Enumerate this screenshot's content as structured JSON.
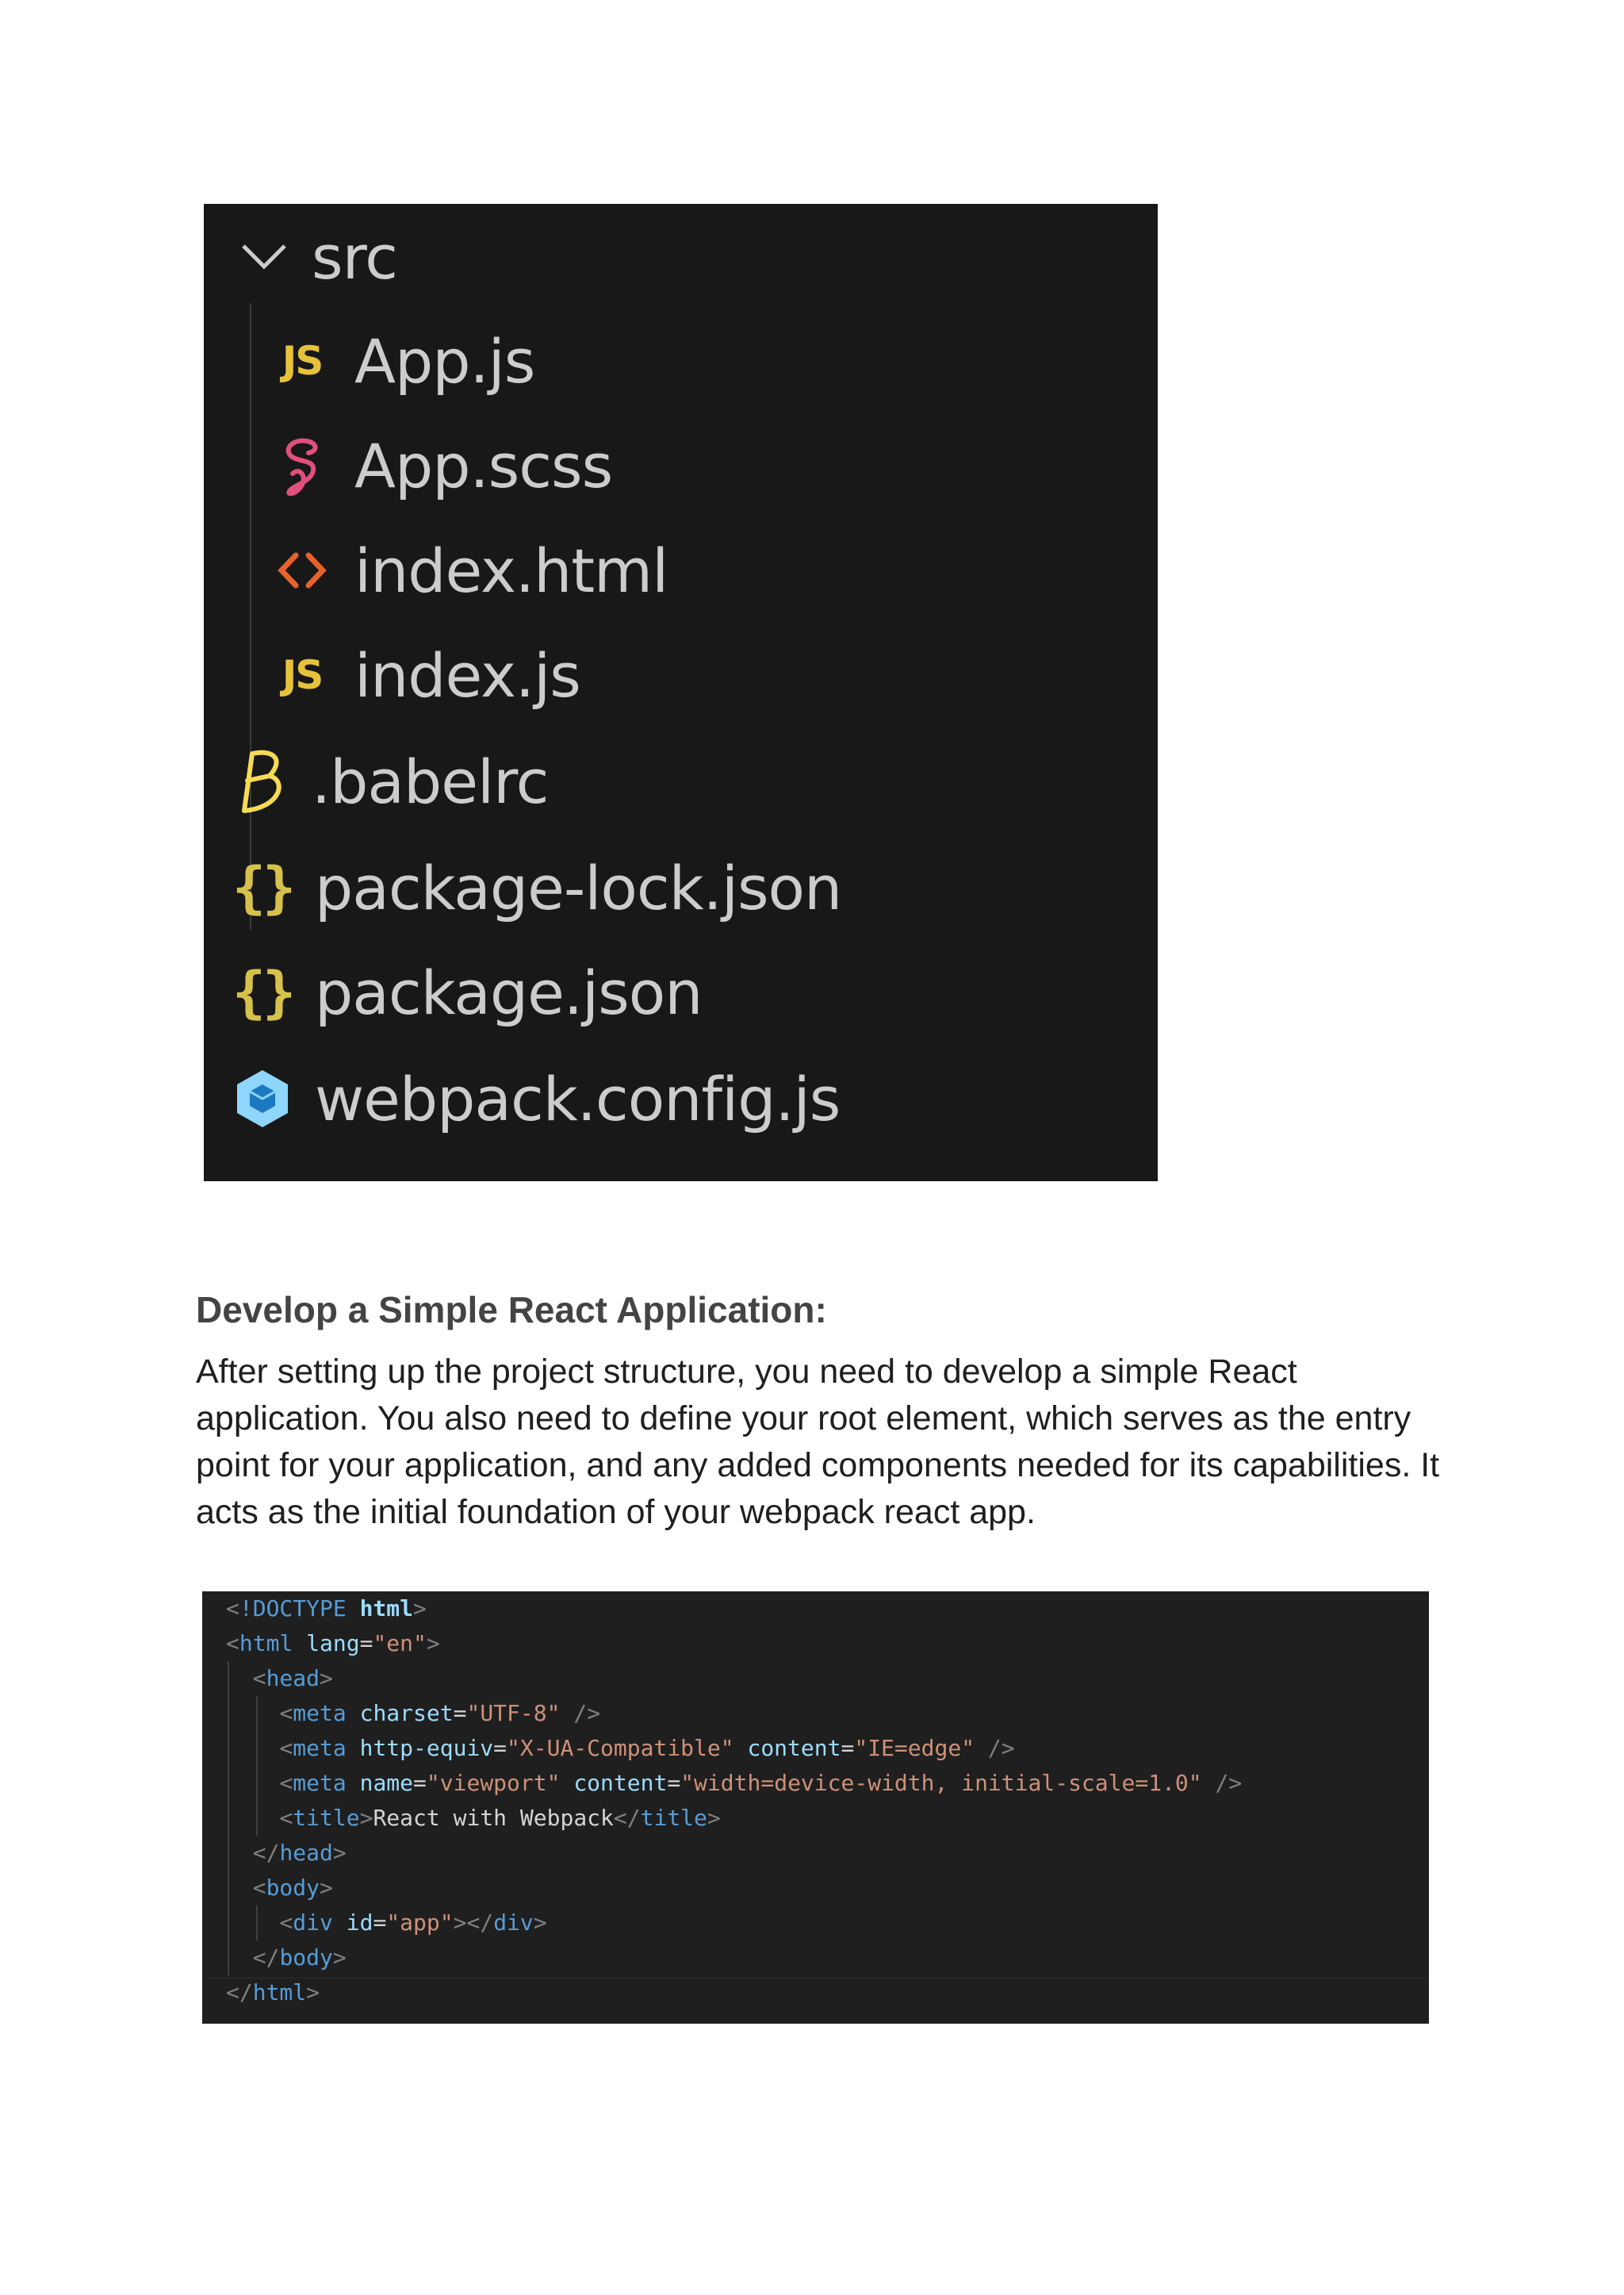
{
  "file_tree": {
    "folder": {
      "name": "src",
      "icon": "chevron-down-icon"
    },
    "src_files": [
      {
        "name": "App.js",
        "icon": "js-file-icon",
        "icon_text": "JS",
        "icon_color": "#e5c23a"
      },
      {
        "name": "App.scss",
        "icon": "sass-file-icon",
        "icon_color": "#e0507a"
      },
      {
        "name": "index.html",
        "icon": "html-file-icon",
        "icon_color": "#e8622c"
      },
      {
        "name": "index.js",
        "icon": "js-file-icon",
        "icon_text": "JS",
        "icon_color": "#e5c23a"
      }
    ],
    "root_files": [
      {
        "name": ".babelrc",
        "icon": "babel-file-icon",
        "icon_color": "#f5da55"
      },
      {
        "name": "package-lock.json",
        "icon": "json-file-icon",
        "icon_text": "{}",
        "icon_color": "#d6c24a"
      },
      {
        "name": "package.json",
        "icon": "json-file-icon",
        "icon_text": "{}",
        "icon_color": "#d6c24a"
      },
      {
        "name": "webpack.config.js",
        "icon": "webpack-file-icon",
        "icon_color": "#8ed6fb"
      }
    ]
  },
  "article": {
    "heading": "Develop a Simple React Application:",
    "paragraph": "After setting up the project structure, you need to develop a simple React application. You also need to define your root element, which serves as the entry point for your application, and any added components needed for its capabilities. It acts as the initial foundation of your webpack react app."
  },
  "code": {
    "line1": {
      "doctype": "!DOCTYPE",
      "html": "html"
    },
    "line2": {
      "tag": "html",
      "attr": "lang",
      "value": "\"en\""
    },
    "line3": {
      "tag": "head"
    },
    "line4": {
      "tag": "meta",
      "attr": "charset",
      "value": "\"UTF-8\""
    },
    "line5": {
      "tag": "meta",
      "attr1": "http-equiv",
      "value1": "\"X-UA-Compatible\"",
      "attr2": "content",
      "value2": "\"IE=edge\""
    },
    "line6": {
      "tag": "meta",
      "attr1": "name",
      "value1": "\"viewport\"",
      "attr2": "content",
      "value2": "\"width=device-width, initial-scale=1.0\""
    },
    "line7": {
      "tag": "title",
      "text": "React with Webpack",
      "close_tag": "title"
    },
    "line8": {
      "tag": "head"
    },
    "line9": {
      "tag": "body"
    },
    "line10": {
      "tag": "div",
      "attr": "id",
      "value": "\"app\"",
      "close_tag": "div"
    },
    "line11": {
      "tag": "body"
    },
    "line12": {
      "tag": "html"
    }
  }
}
